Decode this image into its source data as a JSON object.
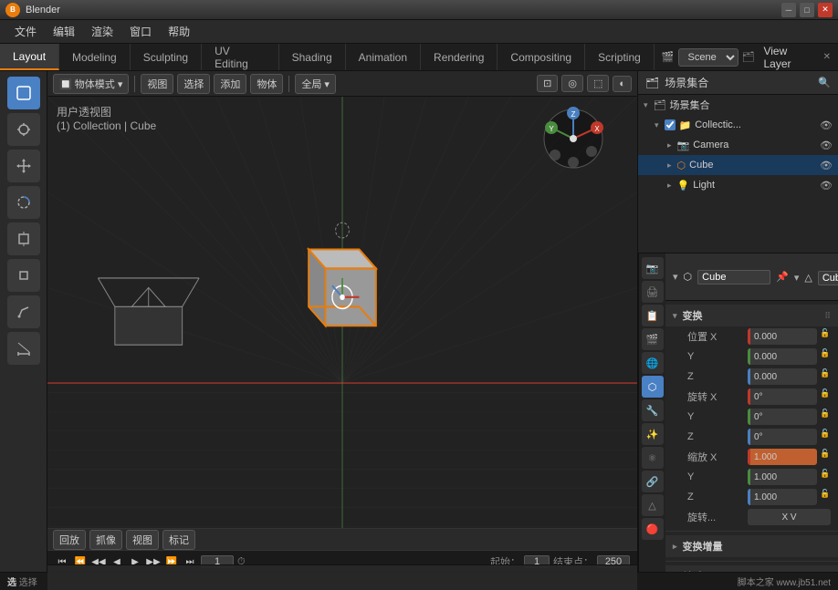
{
  "app": {
    "title": "Blender",
    "logo": "B"
  },
  "titlebar": {
    "title": "Blender",
    "minimize": "─",
    "maximize": "□",
    "close": "✕"
  },
  "menubar": {
    "items": [
      "文件",
      "编辑",
      "渲染",
      "窗口",
      "帮助"
    ]
  },
  "tabs": {
    "items": [
      "Layout",
      "Modeling",
      "Sculpting",
      "UV Editing",
      "Shading",
      "Animation",
      "Rendering",
      "Compositing",
      "Scripting"
    ],
    "active": "Layout"
  },
  "scene": {
    "label": "Scene",
    "value": "Scene"
  },
  "view_layer": {
    "label": "View Layer",
    "value": "View Layer"
  },
  "viewport": {
    "mode_label": "物体模式",
    "view_label": "视图",
    "select_label": "选择",
    "add_label": "添加",
    "object_label": "物体",
    "global_label": "全局",
    "info_line1": "用户透视图",
    "info_line2": "(1) Collection | Cube"
  },
  "timeline": {
    "playback_label": "回放",
    "keying_label": "抓像",
    "view_label": "视图",
    "markers_label": "标记",
    "current_frame": "1",
    "start_label": "起始：",
    "start_value": "1",
    "end_label": "结束点：",
    "end_value": "250"
  },
  "outliner": {
    "title": "场景集合",
    "items": [
      {
        "name": "场景集合",
        "type": "collection",
        "level": 0,
        "expanded": true
      },
      {
        "name": "Collectic...",
        "type": "collection",
        "level": 1,
        "expanded": true
      },
      {
        "name": "Camera",
        "type": "camera",
        "level": 2,
        "expanded": false
      },
      {
        "name": "Cube",
        "type": "mesh",
        "level": 2,
        "expanded": false,
        "active": true
      },
      {
        "name": "Light",
        "type": "light",
        "level": 2,
        "expanded": false
      }
    ]
  },
  "properties": {
    "header": {
      "object_name": "Cube",
      "mesh_name": "Cube"
    },
    "sections": {
      "transform": {
        "label": "变换",
        "expanded": true,
        "position": {
          "label": "位置 X",
          "x": "",
          "y": "",
          "z": ""
        },
        "rotation": {
          "label": "旋转 X",
          "x": "",
          "y": "",
          "z": ""
        },
        "scale": {
          "label": "缩放 X",
          "x": "",
          "y": "",
          "z": ""
        },
        "rotation_mode": {
          "label": "旋转...",
          "value": "X V"
        }
      },
      "transform_delta": {
        "label": "变换增量",
        "expanded": false
      },
      "relations": {
        "label": "关系",
        "expanded": false
      }
    }
  },
  "statusbar": {
    "left": "选择",
    "watermark": "脚本之家 www.jb51.net",
    "collection": "Collection | Cube"
  },
  "tools": {
    "items": [
      "cursor",
      "move",
      "rotate",
      "scale",
      "transform",
      "annotation",
      "measure",
      "add_cube",
      "select_box"
    ]
  },
  "colors": {
    "accent": "#e87d0d",
    "active_tab": "#3a3a3a",
    "selected": "#4a80c4",
    "cube_outline": "#e87d0d",
    "x_axis": "#c0392b",
    "y_axis": "#4a8c3f",
    "z_axis": "#4a7fc0"
  }
}
